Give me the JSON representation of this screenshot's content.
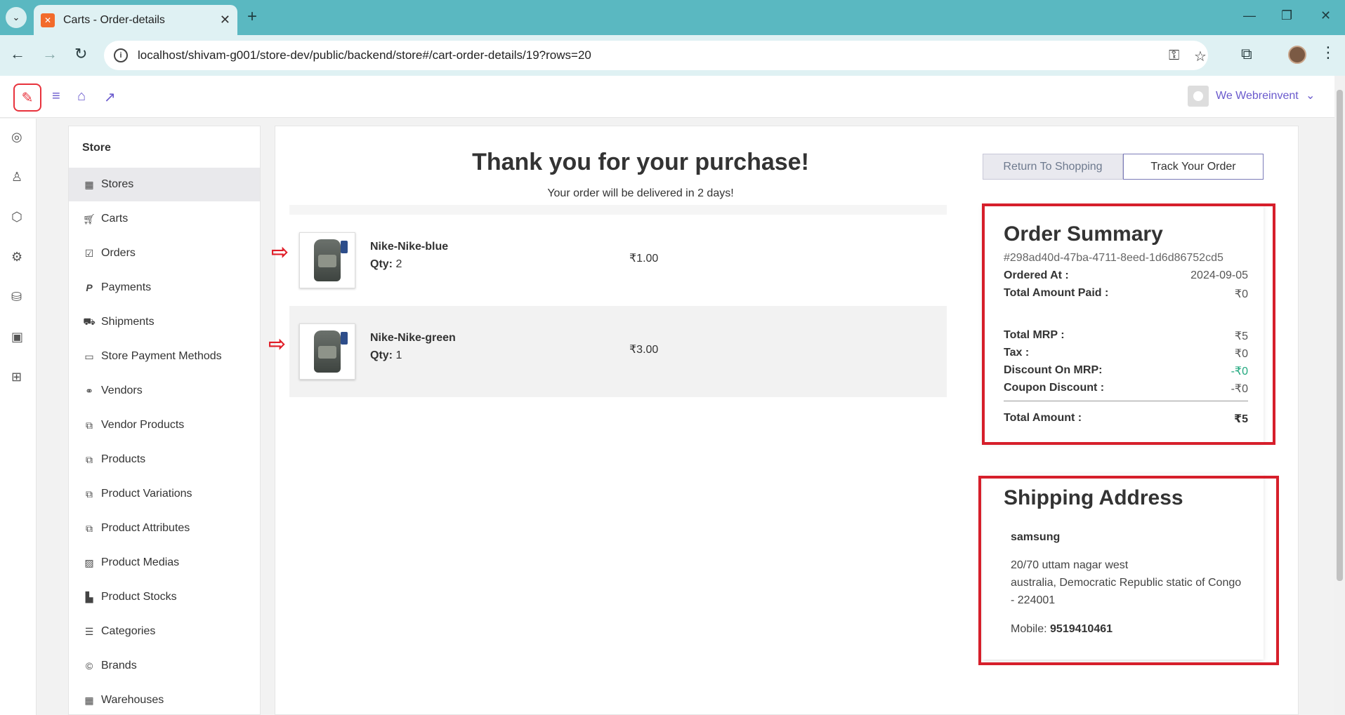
{
  "browser": {
    "tab_title": "Carts - Order-details",
    "url": "localhost/shivam-g001/store-dev/public/backend/store#/cart-order-details/19?rows=20"
  },
  "header": {
    "user_name": "We Webreinvent"
  },
  "sidebar": {
    "title": "Store",
    "items": [
      {
        "label": "Stores",
        "icon": "building-icon"
      },
      {
        "label": "Carts",
        "icon": "cart-icon"
      },
      {
        "label": "Orders",
        "icon": "check-square-icon"
      },
      {
        "label": "Payments",
        "icon": "paypal-icon"
      },
      {
        "label": "Shipments",
        "icon": "truck-icon"
      },
      {
        "label": "Store Payment Methods",
        "icon": "credit-card-icon"
      },
      {
        "label": "Vendors",
        "icon": "handshake-icon"
      },
      {
        "label": "Vendor Products",
        "icon": "copy-icon"
      },
      {
        "label": "Products",
        "icon": "copy-icon"
      },
      {
        "label": "Product Variations",
        "icon": "copy-icon"
      },
      {
        "label": "Product Attributes",
        "icon": "copy-icon"
      },
      {
        "label": "Product Medias",
        "icon": "image-icon"
      },
      {
        "label": "Product Stocks",
        "icon": "chart-icon"
      },
      {
        "label": "Categories",
        "icon": "list-icon"
      },
      {
        "label": "Brands",
        "icon": "copyright-icon"
      },
      {
        "label": "Warehouses",
        "icon": "building-icon"
      }
    ]
  },
  "main": {
    "title": "Thank you for your purchase!",
    "subtitle": "Your order will be delivered in 2 days!",
    "items": [
      {
        "name": "Nike-Nike-blue",
        "qty_label": "Qty:",
        "qty": "2",
        "price": "₹1.00"
      },
      {
        "name": "Nike-Nike-green",
        "qty_label": "Qty:",
        "qty": "1",
        "price": "₹3.00"
      }
    ],
    "return_button": "Return To Shopping",
    "track_button": "Track Your Order"
  },
  "summary": {
    "title": "Order Summary",
    "order_id": "#298ad40d-47ba-4711-8eed-1d6d86752cd5",
    "ordered_at_label": "Ordered At :",
    "ordered_at": "2024-09-05",
    "total_paid_label": "Total Amount Paid :",
    "total_paid": "₹0",
    "mrp_label": "Total MRP :",
    "mrp": "₹5",
    "tax_label": "Tax :",
    "tax": "₹0",
    "discount_label": "Discount On MRP:",
    "discount": "-₹0",
    "coupon_label": "Coupon Discount :",
    "coupon": "-₹0",
    "total_label": "Total Amount :",
    "total": "₹5"
  },
  "shipping": {
    "title": "Shipping Address",
    "name": "samsung",
    "line1": "20/70 uttam nagar west",
    "line2": "australia, Democratic Republic static of Congo - 224001",
    "mobile_label": "Mobile:",
    "mobile": "9519410461"
  },
  "colors": {
    "accent": "#6a5acd",
    "highlight": "#d61f2b",
    "discount_green": "#21a87e"
  }
}
